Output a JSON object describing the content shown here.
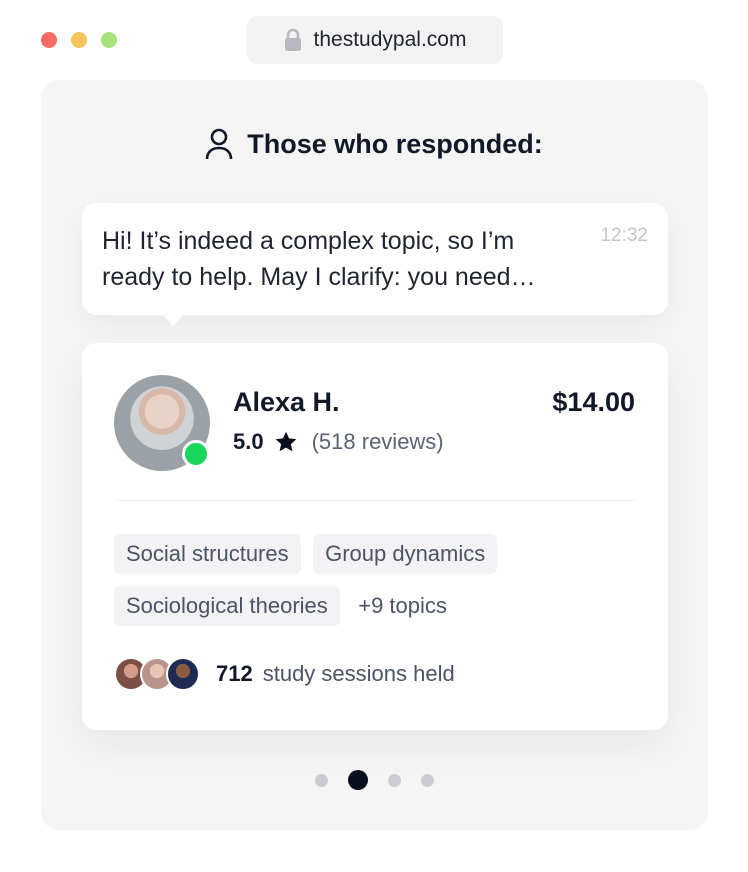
{
  "window": {
    "controls": [
      "close",
      "minimize",
      "maximize"
    ],
    "colors": {
      "close": "#f36c66",
      "minimize": "#f7c45d",
      "maximize": "#a6e47b"
    }
  },
  "browser": {
    "url": "thestudypal.com",
    "lock_icon": "lock-icon"
  },
  "section": {
    "icon": "user-icon",
    "title": "Those who responded:"
  },
  "message": {
    "text": "Hi! It’s indeed a complex topic, so I’m ready to help. May I clarify: you need…",
    "time": "12:32"
  },
  "tutor": {
    "name": "Alexa H.",
    "price": "$14.00",
    "rating": "5.0",
    "reviews": "(518 reviews)",
    "online": true,
    "status_color": "#19d65a",
    "topics": [
      "Social structures",
      "Group dynamics",
      "Sociological theories"
    ],
    "more_topics": "+9 topics",
    "sessions_count": "712",
    "sessions_label": "study sessions held"
  },
  "pagination": {
    "total": 4,
    "active_index": 1
  }
}
